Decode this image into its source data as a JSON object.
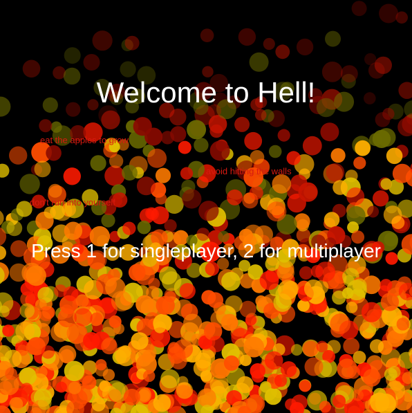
{
  "screen": {
    "title": "Welcome to Hell!",
    "hints": [
      "eat the apples to grow",
      "avoid hitting the walls",
      "don't run into yourself"
    ],
    "prompt": "Press 1 for singleplayer, 2 for multiplayer"
  },
  "colors": {
    "background": "#000000",
    "title_text": "#ffffff",
    "hint_text": "#d81a10",
    "particle_palette": [
      "#ff1a00",
      "#ff4d00",
      "#ff7a00",
      "#ffae00",
      "#e0c000",
      "#c81400",
      "#8a0a00",
      "#6b6b00"
    ]
  }
}
